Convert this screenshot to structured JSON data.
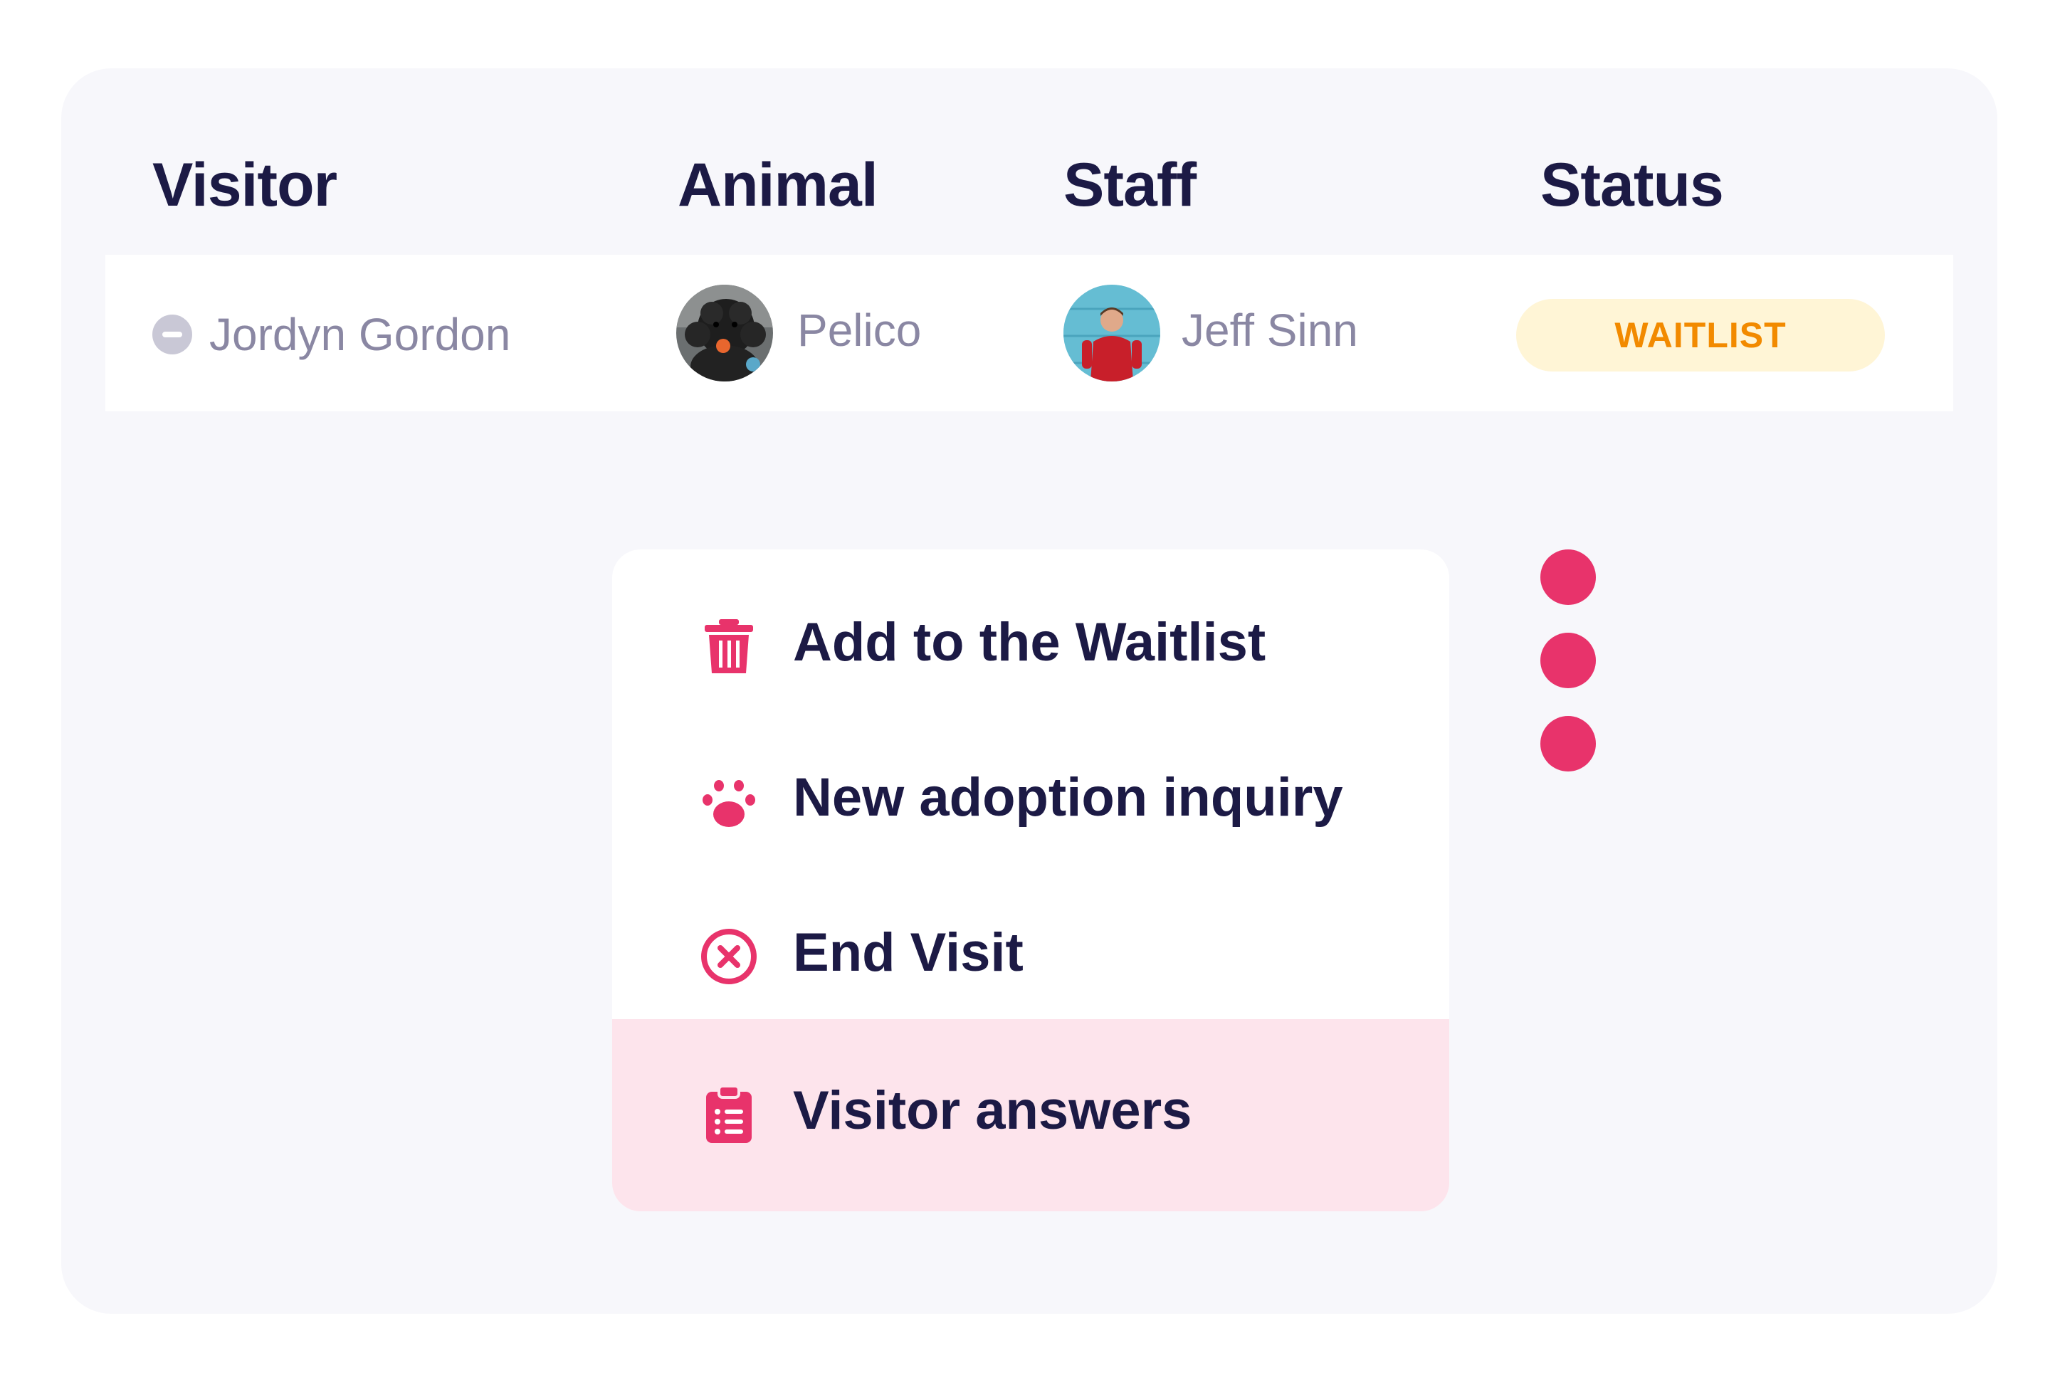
{
  "table": {
    "headers": {
      "visitor": "Visitor",
      "animal": "Animal",
      "staff": "Staff",
      "status": "Status"
    },
    "row": {
      "visitor": "Jordyn Gordon",
      "animal": "Pelico",
      "staff": "Jeff Sinn",
      "status": "WAITLIST"
    }
  },
  "menu": {
    "items": [
      {
        "label": "Add to the Waitlist",
        "icon": "trash-icon"
      },
      {
        "label": "New adoption inquiry",
        "icon": "paw-icon"
      },
      {
        "label": "End Visit",
        "icon": "close-circle-icon"
      },
      {
        "label": "Visitor answers",
        "icon": "clipboard-list-icon",
        "highlighted": true
      }
    ]
  },
  "colors": {
    "accent": "#e8336b",
    "heading": "#1c1a45",
    "muted_text": "#8a87a3",
    "status_text": "#f28a00",
    "status_bg": "#fff5d6",
    "highlight_bg": "#fde4ec",
    "card_bg": "#f7f7fb"
  }
}
